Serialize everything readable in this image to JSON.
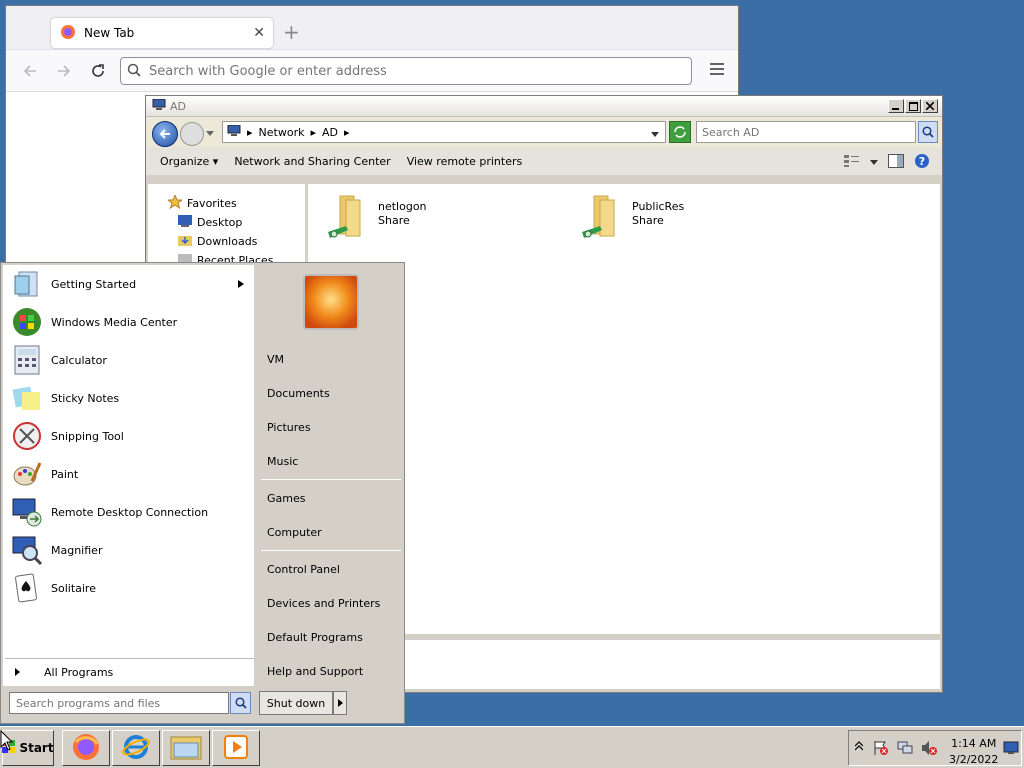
{
  "firefox": {
    "tab_title": "New Tab",
    "urlbar_placeholder": "Search with Google or enter address"
  },
  "explorer": {
    "title": "AD",
    "breadcrumb": [
      "Network",
      "AD"
    ],
    "search_placeholder": "Search AD",
    "toolbar": {
      "organize": "Organize",
      "network_sharing": "Network and Sharing Center",
      "view_printers": "View remote printers"
    },
    "nav": {
      "favorites": "Favorites",
      "desktop": "Desktop",
      "downloads": "Downloads",
      "recent": "Recent Places"
    },
    "shares": [
      {
        "name": "netlogon",
        "type": "Share"
      },
      {
        "name": "PublicRes",
        "type": "Share"
      }
    ]
  },
  "start_menu": {
    "programs": [
      {
        "label": "Getting Started",
        "icon": "getting-started-icon"
      },
      {
        "label": "Windows Media Center",
        "icon": "media-center-icon"
      },
      {
        "label": "Calculator",
        "icon": "calculator-icon"
      },
      {
        "label": "Sticky Notes",
        "icon": "sticky-notes-icon"
      },
      {
        "label": "Snipping Tool",
        "icon": "snipping-tool-icon"
      },
      {
        "label": "Paint",
        "icon": "paint-icon"
      },
      {
        "label": "Remote Desktop Connection",
        "icon": "remote-desktop-icon"
      },
      {
        "label": "Magnifier",
        "icon": "magnifier-icon"
      },
      {
        "label": "Solitaire",
        "icon": "solitaire-icon"
      }
    ],
    "all_programs": "All Programs",
    "right_items": {
      "user": "VM",
      "documents": "Documents",
      "pictures": "Pictures",
      "music": "Music",
      "games": "Games",
      "computer": "Computer",
      "control_panel": "Control Panel",
      "devices": "Devices and Printers",
      "default_programs": "Default Programs",
      "help": "Help and Support"
    },
    "search_placeholder": "Search programs and files",
    "shutdown": "Shut down"
  },
  "taskbar": {
    "start": "Start",
    "time": "1:14 AM",
    "date": "3/2/2022"
  }
}
